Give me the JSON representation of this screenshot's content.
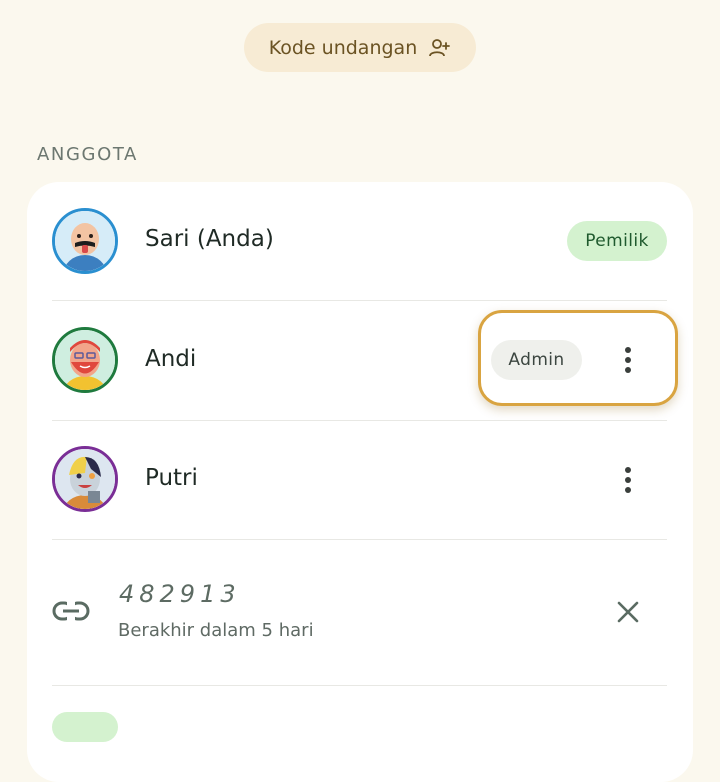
{
  "invite": {
    "label": "Kode undangan",
    "icon": "person-add-icon"
  },
  "section": {
    "title": "ANGGOTA"
  },
  "members": [
    {
      "name": "Sari (Anda)",
      "role": "Pemilik",
      "ring_color": "#2a8fd0"
    },
    {
      "name": "Andi",
      "role": "Admin",
      "ring_color": "#1f7a3e"
    },
    {
      "name": "Putri",
      "role": "",
      "ring_color": "#7a2e96"
    }
  ],
  "invite_code": {
    "code": "482913",
    "expiry": "Berakhir dalam 5 hari",
    "icon": "link-icon"
  },
  "colors": {
    "background": "#fbf8ee",
    "owner_badge": "#d4f2cf",
    "highlight": "#d9a441"
  }
}
